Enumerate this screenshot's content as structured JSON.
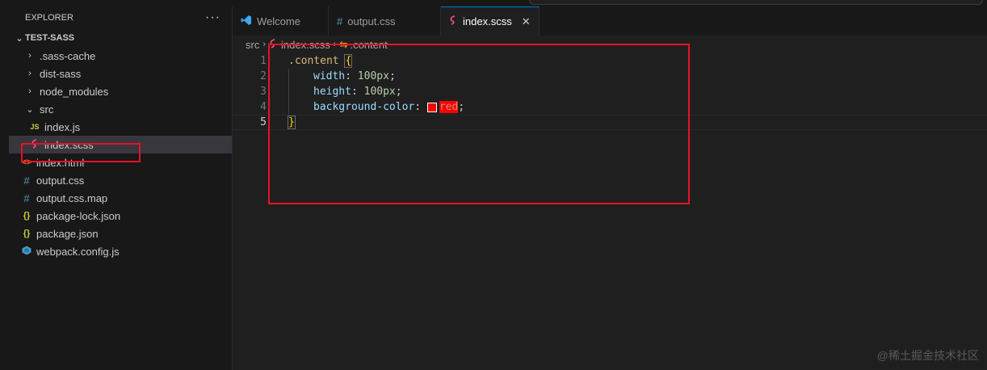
{
  "explorer": {
    "title": "EXPLORER",
    "more_label": "···",
    "project": "TEST-SASS",
    "items": [
      {
        "label": ".sass-cache",
        "icon": "chevron-right",
        "type": "folder"
      },
      {
        "label": "dist-sass",
        "icon": "chevron-right",
        "type": "folder"
      },
      {
        "label": "node_modules",
        "icon": "chevron-right",
        "type": "folder"
      },
      {
        "label": "src",
        "icon": "chevron-down",
        "type": "folder-open"
      },
      {
        "label": "index.js",
        "icon": "js-icon",
        "type": "file"
      },
      {
        "label": "index.scss",
        "icon": "sass-icon",
        "type": "file"
      },
      {
        "label": "index.html",
        "icon": "html-icon",
        "type": "file"
      },
      {
        "label": "output.css",
        "icon": "css-icon",
        "type": "file"
      },
      {
        "label": "output.css.map",
        "icon": "css-icon",
        "type": "file"
      },
      {
        "label": "package-lock.json",
        "icon": "json-icon",
        "type": "file"
      },
      {
        "label": "package.json",
        "icon": "json-icon",
        "type": "file"
      },
      {
        "label": "webpack.config.js",
        "icon": "webpack-icon",
        "type": "file"
      }
    ]
  },
  "tabs": [
    {
      "label": "Welcome",
      "icon": "vscode-icon"
    },
    {
      "label": "output.css",
      "icon": "css-icon"
    },
    {
      "label": "index.scss",
      "icon": "sass-icon",
      "active": true
    }
  ],
  "breadcrumb": {
    "part1": "src",
    "part2": "index.scss",
    "part3": ".content"
  },
  "code": {
    "l1_selector": ".content",
    "l1_brace": "{",
    "l2_prop": "width",
    "l2_val": "100px",
    "l3_prop": "height",
    "l3_val": "100px",
    "l4_prop": "background-color",
    "l4_val": "red",
    "l5_brace": "}",
    "colon": ":",
    "semi": ";",
    "line_numbers": [
      "1",
      "2",
      "3",
      "4",
      "5"
    ]
  },
  "watermark": "@稀土掘金技术社区",
  "colors": {
    "accent": "#0078d4",
    "highlight_box": "#e81123",
    "swatch": "#ff0000"
  }
}
